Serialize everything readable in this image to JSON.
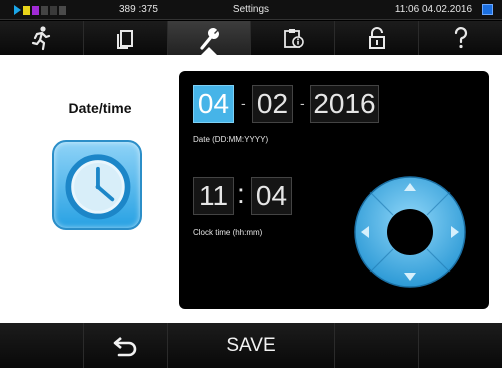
{
  "status": {
    "counter": "389 :375",
    "title": "Settings",
    "datetime": "11:06  04.02.2016"
  },
  "nav": {
    "active_tab": "settings",
    "tabs": [
      {
        "icon": "running-person-icon"
      },
      {
        "icon": "documents-icon"
      },
      {
        "icon": "wrench-icon"
      },
      {
        "icon": "clipboard-info-icon"
      },
      {
        "icon": "padlock-icon"
      },
      {
        "icon": "question-mark-icon"
      }
    ]
  },
  "side": {
    "title": "Date/time",
    "icon": "clock-icon"
  },
  "date": {
    "day": "04",
    "month": "02",
    "year": "2016",
    "separator": "-",
    "caption": "Date (DD:MM:YYYY)"
  },
  "time": {
    "hours": "11",
    "minutes": "04",
    "separator": ":",
    "caption": "Clock time (hh:mm)"
  },
  "dpad": {
    "icon": "direction-pad-icon"
  },
  "bottom": {
    "back_icon": "back-arrow-icon",
    "save_label": "SAVE"
  },
  "colors": {
    "accent": "#46b4e8",
    "panel": "#000000",
    "content_bg": "#ffffff"
  }
}
